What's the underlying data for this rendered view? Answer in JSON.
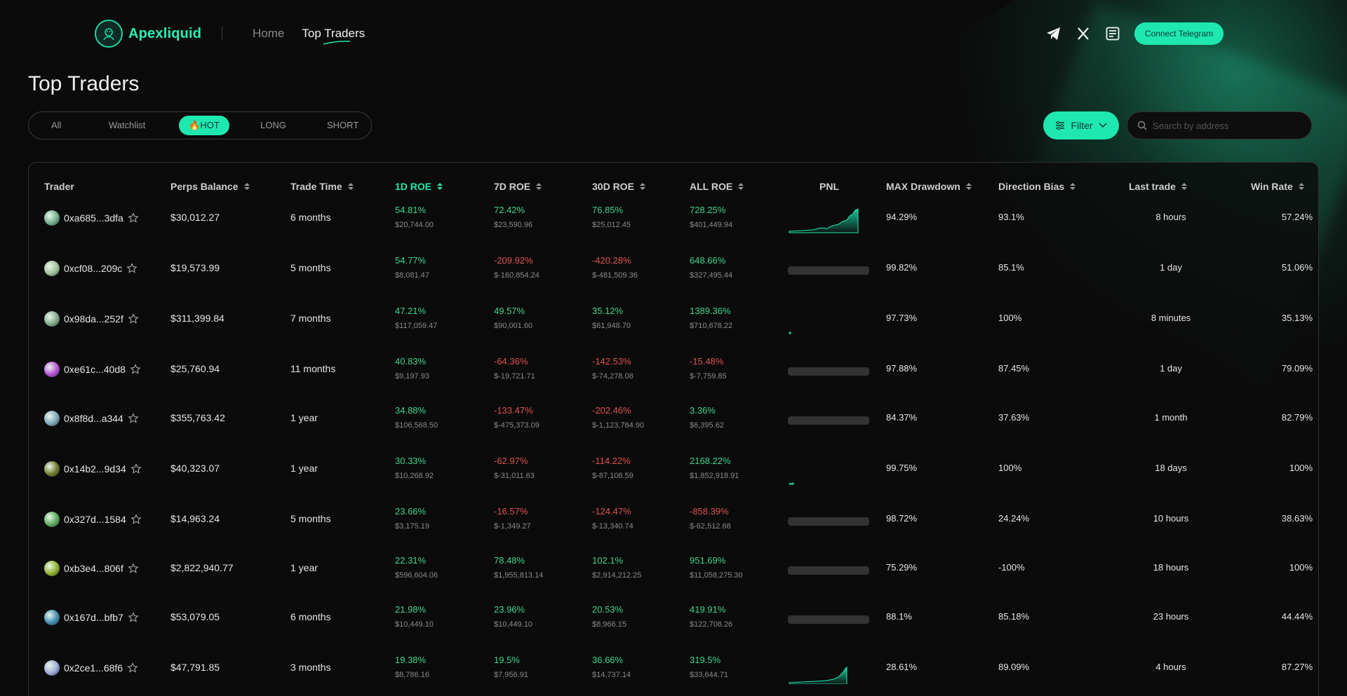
{
  "brand": {
    "name": "Apexliquid",
    "accent": "#1ee8b0"
  },
  "nav": {
    "home": "Home",
    "top_traders": "Top Traders"
  },
  "header_icons": [
    "telegram-icon",
    "x-icon",
    "docs-icon"
  ],
  "connect_label": "Connect Telegram",
  "page_title": "Top Traders",
  "tabs": {
    "all": "All",
    "watchlist": "Watchlist",
    "hot": "🔥HOT",
    "long": "LONG",
    "short": "SHORT",
    "active": "hot"
  },
  "filter_label": "Filter",
  "search_placeholder": "Search by address",
  "columns": {
    "trader": "Trader",
    "balance": "Perps Balance",
    "time": "Trade Time",
    "roe1d": "1D ROE",
    "roe7d": "7D ROE",
    "roe30d": "30D ROE",
    "roeall": "ALL ROE",
    "pnl": "PNL",
    "drawdown": "MAX Drawdown",
    "bias": "Direction Bias",
    "last": "Last trade",
    "win": "Win Rate"
  },
  "rows": [
    {
      "addr": "0xa685...3dfa",
      "avatar": "#6fae8a",
      "balance": "$30,012.27",
      "time": "6 months",
      "r1": "54.81%",
      "a1": "$20,744.00",
      "r7": "72.42%",
      "a7": "$23,590.96",
      "r30": "76.85%",
      "a30": "$25,012.45",
      "ra": "728.25%",
      "aa": "$401,449.94",
      "pnl": "spark",
      "dd": "94.29%",
      "bias": "93.1%",
      "last": "8 hours",
      "win": "57.24%"
    },
    {
      "addr": "0xcf08...209c",
      "avatar": "#9fbf9a",
      "balance": "$19,573.99",
      "time": "5 months",
      "r1": "54.77%",
      "a1": "$8,081.47",
      "r7": "-209.92%",
      "a7": "$-160,854.24",
      "r30": "-420.28%",
      "a30": "$-481,509.36",
      "ra": "648.66%",
      "aa": "$327,495.44",
      "pnl": "bar",
      "dd": "99.82%",
      "bias": "85.1%",
      "last": "1 day",
      "win": "51.06%"
    },
    {
      "addr": "0x98da...252f",
      "avatar": "#7da88a",
      "balance": "$311,399.84",
      "time": "7 months",
      "r1": "47.21%",
      "a1": "$117,059.47",
      "r7": "49.57%",
      "a7": "$90,001.60",
      "r30": "35.12%",
      "a30": "$61,948.70",
      "ra": "1389.36%",
      "aa": "$710,678.22",
      "pnl": "dot",
      "dd": "97.73%",
      "bias": "100%",
      "last": "8 minutes",
      "win": "35.13%"
    },
    {
      "addr": "0xe61c...40d8",
      "avatar": "#b84fd8",
      "balance": "$25,760.94",
      "time": "11 months",
      "r1": "40.83%",
      "a1": "$9,197.93",
      "r7": "-64.36%",
      "a7": "$-19,721.71",
      "r30": "-142.53%",
      "a30": "$-74,278.08",
      "ra": "-15.48%",
      "aa": "$-7,759.85",
      "pnl": "bar",
      "dd": "97.88%",
      "bias": "87.45%",
      "last": "1 day",
      "win": "79.09%"
    },
    {
      "addr": "0x8f8d...a344",
      "avatar": "#7aa6b8",
      "balance": "$355,763.42",
      "time": "1 year",
      "r1": "34.88%",
      "a1": "$106,568.50",
      "r7": "-133.47%",
      "a7": "$-475,373.09",
      "r30": "-202.46%",
      "a30": "$-1,123,784.90",
      "ra": "3.36%",
      "aa": "$6,395.62",
      "pnl": "bar",
      "dd": "84.37%",
      "bias": "37.63%",
      "last": "1 month",
      "win": "82.79%"
    },
    {
      "addr": "0x14b2...9d34",
      "avatar": "#6d7a2a",
      "balance": "$40,323.07",
      "time": "1 year",
      "r1": "30.33%",
      "a1": "$10,268.92",
      "r7": "-62.97%",
      "a7": "$-31,011.63",
      "r30": "-114.22%",
      "a30": "$-87,108.59",
      "ra": "2168.22%",
      "aa": "$1,852,918.91",
      "pnl": "tick",
      "dd": "99.75%",
      "bias": "100%",
      "last": "18 days",
      "win": "100%"
    },
    {
      "addr": "0x327d...1584",
      "avatar": "#58a85a",
      "balance": "$14,963.24",
      "time": "5 months",
      "r1": "23.66%",
      "a1": "$3,175.19",
      "r7": "-16.57%",
      "a7": "$-1,349.27",
      "r30": "-124.47%",
      "a30": "$-13,340.74",
      "ra": "-858.39%",
      "aa": "$-62,512.68",
      "pnl": "bar",
      "dd": "98.72%",
      "bias": "24.24%",
      "last": "10 hours",
      "win": "38.63%"
    },
    {
      "addr": "0xb3e4...806f",
      "avatar": "#8fb02a",
      "balance": "$2,822,940.77",
      "time": "1 year",
      "r1": "22.31%",
      "a1": "$596,604.06",
      "r7": "78.48%",
      "a7": "$1,955,813.14",
      "r30": "102.1%",
      "a30": "$2,914,212.25",
      "ra": "951.69%",
      "aa": "$11,058,275.30",
      "pnl": "bar",
      "dd": "75.29%",
      "bias": "-100%",
      "last": "18 hours",
      "win": "100%"
    },
    {
      "addr": "0x167d...bfb7",
      "avatar": "#3f8ab0",
      "balance": "$53,079.05",
      "time": "6 months",
      "r1": "21.98%",
      "a1": "$10,449.10",
      "r7": "23.96%",
      "a7": "$10,449.10",
      "r30": "20.53%",
      "a30": "$8,966.15",
      "ra": "419.91%",
      "aa": "$122,708.26",
      "pnl": "bar",
      "dd": "88.1%",
      "bias": "85.18%",
      "last": "23 hours",
      "win": "44.44%"
    },
    {
      "addr": "0x2ce1...68f6",
      "avatar": "#9aa8d8",
      "balance": "$47,791.85",
      "time": "3 months",
      "r1": "19.38%",
      "a1": "$8,786.16",
      "r7": "19.5%",
      "a7": "$7,956.91",
      "r30": "36.66%",
      "a30": "$14,737.14",
      "ra": "319.5%",
      "aa": "$33,644.71",
      "pnl": "spark2",
      "dd": "28.61%",
      "bias": "89.09%",
      "last": "4 hours",
      "win": "87.27%"
    }
  ]
}
